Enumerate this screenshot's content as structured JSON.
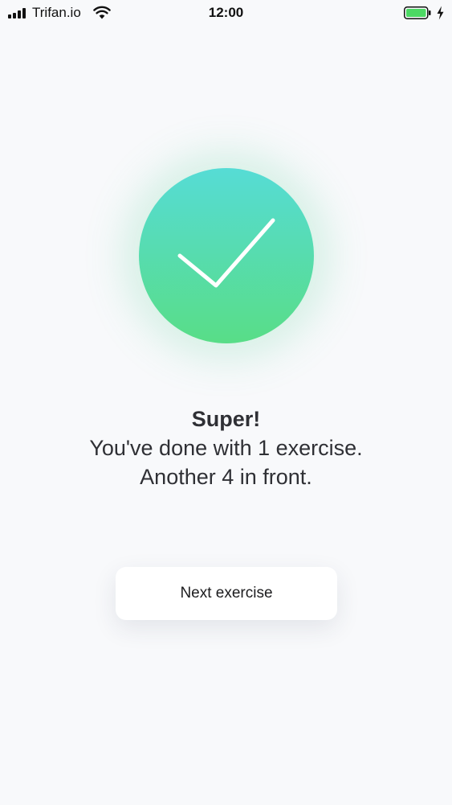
{
  "status_bar": {
    "carrier": "Trifan.io",
    "time": "12:00",
    "battery_color": "#4cd964"
  },
  "success": {
    "gradient_top": "#56dcd5",
    "gradient_bottom": "#58dd87",
    "icon": "checkmark-icon"
  },
  "message": {
    "title": "Super!",
    "line1": "You've done with 1 exercise.",
    "line2": "Another 4 in front."
  },
  "actions": {
    "next_label": "Next exercise"
  }
}
